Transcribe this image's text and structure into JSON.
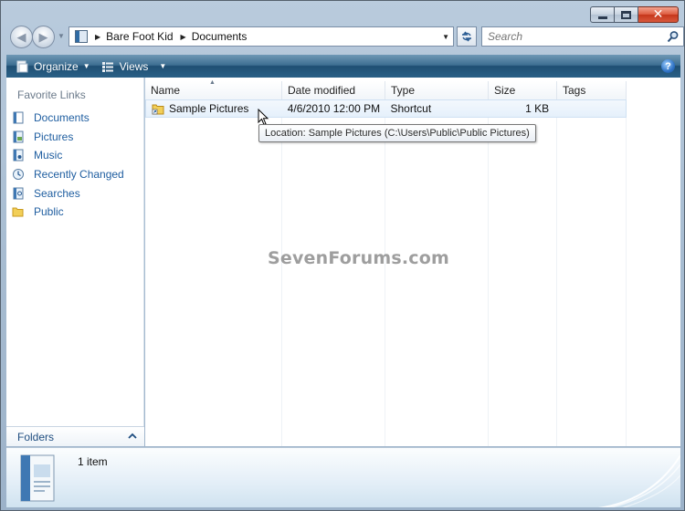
{
  "window": {
    "caption_buttons": {
      "minimize": "minimize",
      "maximize": "maximize",
      "close": "✕"
    }
  },
  "address_bar": {
    "breadcrumbs": [
      "Bare Foot Kid",
      "Documents"
    ],
    "search_placeholder": "Search"
  },
  "toolbar": {
    "organize_label": "Organize",
    "views_label": "Views",
    "help_label": "?"
  },
  "sidebar": {
    "header": "Favorite Links",
    "items": [
      {
        "label": "Documents",
        "icon": "documents-icon"
      },
      {
        "label": "Pictures",
        "icon": "pictures-icon"
      },
      {
        "label": "Music",
        "icon": "music-icon"
      },
      {
        "label": "Recently Changed",
        "icon": "recently-changed-icon"
      },
      {
        "label": "Searches",
        "icon": "searches-icon"
      },
      {
        "label": "Public",
        "icon": "public-folder-icon"
      }
    ],
    "folders_label": "Folders"
  },
  "file_list": {
    "columns": [
      "Name",
      "Date modified",
      "Type",
      "Size",
      "Tags"
    ],
    "rows": [
      {
        "name": "Sample Pictures",
        "date_modified": "4/6/2010 12:00 PM",
        "type": "Shortcut",
        "size": "1 KB",
        "tags": ""
      }
    ],
    "tooltip": "Location: Sample Pictures (C:\\Users\\Public\\Public Pictures)",
    "watermark": "SevenForums.com"
  },
  "details": {
    "item_count": "1 item"
  },
  "colors": {
    "toolbar": "#2a5f86",
    "link": "#1f5ea0",
    "selection": "#e5f0fb"
  }
}
